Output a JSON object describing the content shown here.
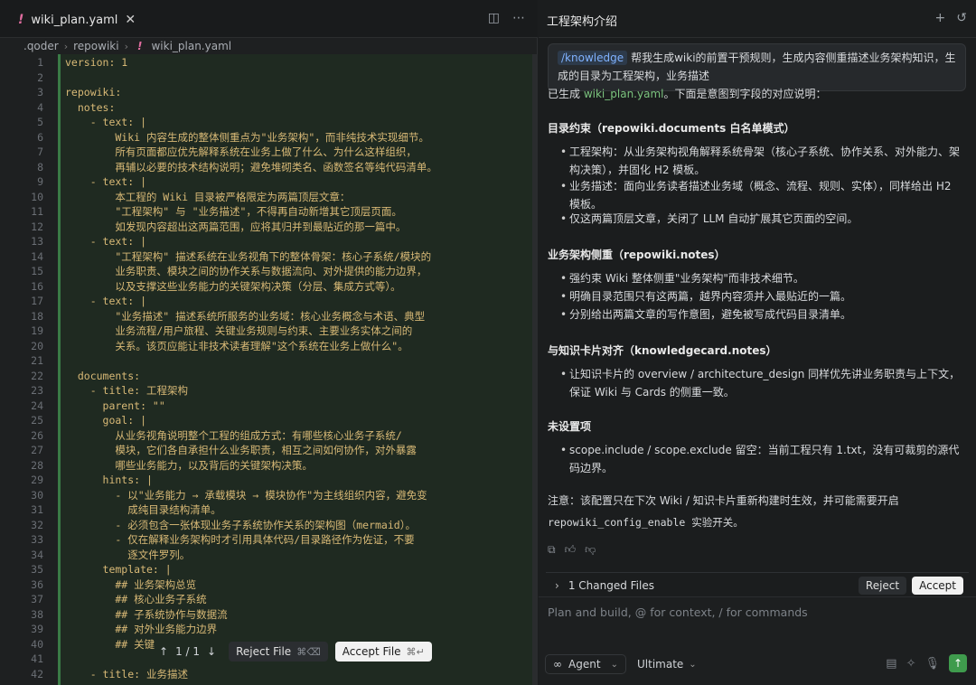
{
  "editor": {
    "tab": {
      "icon": "!",
      "label": "wiki_plan.yaml",
      "close": "✕"
    },
    "breadcrumb": [
      ".qoder",
      "repowiki",
      "wiki_plan.yaml"
    ],
    "lines": [
      {
        "n": "1",
        "t": "version: 1"
      },
      {
        "n": "2",
        "t": ""
      },
      {
        "n": "3",
        "t": "repowiki:"
      },
      {
        "n": "4",
        "t": "  notes:"
      },
      {
        "n": "5",
        "t": "    - text: |"
      },
      {
        "n": "6",
        "t": "        Wiki 内容生成的整体侧重点为\"业务架构\"，而非纯技术实现细节。"
      },
      {
        "n": "7",
        "t": "        所有页面都应优先解释系统在业务上做了什么、为什么这样组织，"
      },
      {
        "n": "8",
        "t": "        再辅以必要的技术结构说明；避免堆砌类名、函数签名等纯代码清单。"
      },
      {
        "n": "9",
        "t": "    - text: |"
      },
      {
        "n": "10",
        "t": "        本工程的 Wiki 目录被严格限定为两篇顶层文章："
      },
      {
        "n": "11",
        "t": "        \"工程架构\" 与 \"业务描述\"，不得再自动新增其它顶层页面。"
      },
      {
        "n": "12",
        "t": "        如发现内容超出这两篇范围，应将其归并到最贴近的那一篇中。"
      },
      {
        "n": "13",
        "t": "    - text: |"
      },
      {
        "n": "14",
        "t": "        \"工程架构\" 描述系统在业务视角下的整体骨架：核心子系统/模块的"
      },
      {
        "n": "15",
        "t": "        业务职责、模块之间的协作关系与数据流向、对外提供的能力边界，"
      },
      {
        "n": "16",
        "t": "        以及支撑这些业务能力的关键架构决策（分层、集成方式等）。"
      },
      {
        "n": "17",
        "t": "    - text: |"
      },
      {
        "n": "18",
        "t": "        \"业务描述\" 描述系统所服务的业务域：核心业务概念与术语、典型"
      },
      {
        "n": "19",
        "t": "        业务流程/用户旅程、关键业务规则与约束、主要业务实体之间的"
      },
      {
        "n": "20",
        "t": "        关系。该页应能让非技术读者理解\"这个系统在业务上做什么\"。"
      },
      {
        "n": "21",
        "t": ""
      },
      {
        "n": "22",
        "t": "  documents:"
      },
      {
        "n": "23",
        "t": "    - title: 工程架构"
      },
      {
        "n": "24",
        "t": "      parent: \"\""
      },
      {
        "n": "25",
        "t": "      goal: |"
      },
      {
        "n": "26",
        "t": "        从业务视角说明整个工程的组成方式：有哪些核心业务子系统/"
      },
      {
        "n": "27",
        "t": "        模块，它们各自承担什么业务职责，相互之间如何协作，对外暴露"
      },
      {
        "n": "28",
        "t": "        哪些业务能力，以及背后的关键架构决策。"
      },
      {
        "n": "29",
        "t": "      hints: |"
      },
      {
        "n": "30",
        "t": "        - 以\"业务能力 → 承载模块 → 模块协作\"为主线组织内容，避免变"
      },
      {
        "n": "31",
        "t": "          成纯目录结构清单。"
      },
      {
        "n": "32",
        "t": "        - 必须包含一张体现业务子系统协作关系的架构图（mermaid）。"
      },
      {
        "n": "33",
        "t": "        - 仅在解释业务架构时才引用具体代码/目录路径作为佐证，不要"
      },
      {
        "n": "34",
        "t": "          逐文件罗列。"
      },
      {
        "n": "35",
        "t": "      template: |"
      },
      {
        "n": "36",
        "t": "        ## 业务架构总览"
      },
      {
        "n": "37",
        "t": "        ## 核心业务子系统"
      },
      {
        "n": "38",
        "t": "        ## 子系统协作与数据流"
      },
      {
        "n": "39",
        "t": "        ## 对外业务能力边界"
      },
      {
        "n": "40",
        "t": "        ## 关键"
      },
      {
        "n": "41",
        "t": ""
      },
      {
        "n": "42",
        "t": "    - title: 业务描述"
      }
    ],
    "float_bar": {
      "counter": "1 / 1",
      "reject_label": "Reject File",
      "reject_kbd": "⌘⌫",
      "accept_label": "Accept File",
      "accept_kbd": "⌘↵"
    }
  },
  "chat": {
    "title": "工程架构介绍",
    "user_message": {
      "chip": "/knowledge",
      "text": "帮我生成wiki的前置干预规则，生成内容侧重描述业务架构知识，生成的目录为工程架构，业务描述"
    },
    "reply": {
      "intro_a": "已生成 ",
      "intro_file": "wiki_plan.yaml",
      "intro_b": "。下面是意图到字段的对应说明：",
      "s1_title": "目录约束（repowiki.documents 白名单模式）",
      "s1_items": [
        "工程架构：从业务架构视角解释系统骨架（核心子系统、协作关系、对外能力、架构决策），并固化 H2 模板。",
        "业务描述：面向业务读者描述业务域（概念、流程、规则、实体），同样给出 H2 模板。",
        "仅这两篇顶层文章，关闭了 LLM 自动扩展其它页面的空间。"
      ],
      "s2_title": "业务架构侧重（repowiki.notes）",
      "s2_items": [
        "强约束 Wiki 整体侧重\"业务架构\"而非技术细节。",
        "明确目录范围只有这两篇，越界内容须并入最贴近的一篇。",
        "分别给出两篇文章的写作意图，避免被写成代码目录清单。"
      ],
      "s3_title": "与知识卡片对齐（knowledgecard.notes）",
      "s3_items": [
        "让知识卡片的 overview / architecture_design 同样优先讲业务职责与上下文，保证 Wiki 与 Cards 的侧重一致。"
      ],
      "s4_title": "未设置项",
      "s4_items": [
        "scope.include / scope.exclude 留空：当前工程只有 1.txt，没有可裁剪的源代码边界。"
      ],
      "note_a": "注意：该配置只在下次 Wiki / 知识卡片重新构建时生效，并可能需要开启",
      "note_b": "repowiki_config_enable 实验开关。"
    },
    "changed": {
      "label": "1 Changed Files",
      "reject": "Reject",
      "accept": "Accept"
    },
    "input": {
      "placeholder": "Plan and build, @ for context, / for commands",
      "agent_label": "Agent",
      "model_label": "Ultimate"
    }
  },
  "colors": {
    "accent_green": "#3f9b4d",
    "yaml_text": "#d8b976",
    "link_blue": "#7fb2ff"
  }
}
